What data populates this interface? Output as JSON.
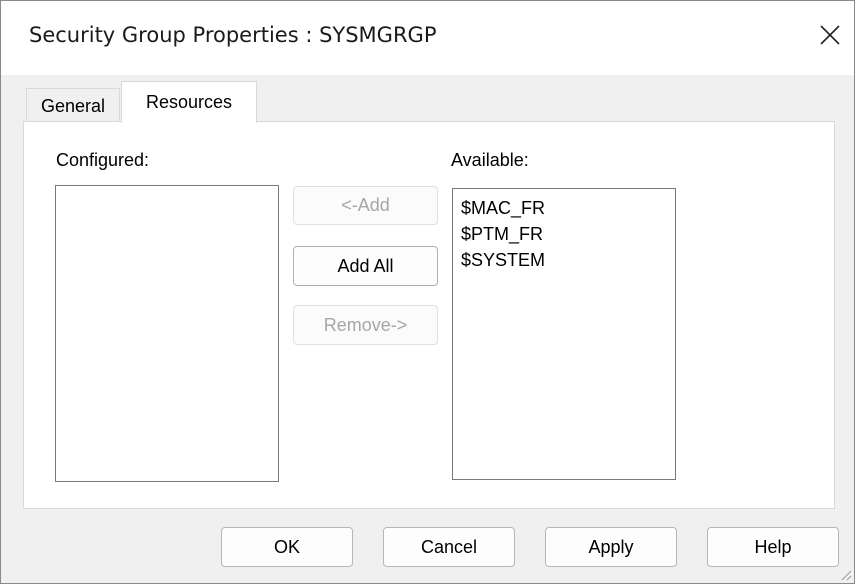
{
  "window": {
    "title": "Security Group Properties : SYSMGRGP"
  },
  "tabs": [
    {
      "label": "General"
    },
    {
      "label": "Resources"
    }
  ],
  "resources": {
    "configured_label": "Configured:",
    "available_label": "Available:",
    "configured_items": [],
    "available_items": [
      "$MAC_FR",
      "$PTM_FR",
      "$SYSTEM"
    ],
    "buttons": {
      "add": "<-Add",
      "add_all": "Add All",
      "remove": "Remove->"
    }
  },
  "footer": {
    "ok": "OK",
    "cancel": "Cancel",
    "apply": "Apply",
    "help": "Help"
  },
  "icons": {
    "close": "close-icon",
    "resize": "size-grip-icon"
  }
}
